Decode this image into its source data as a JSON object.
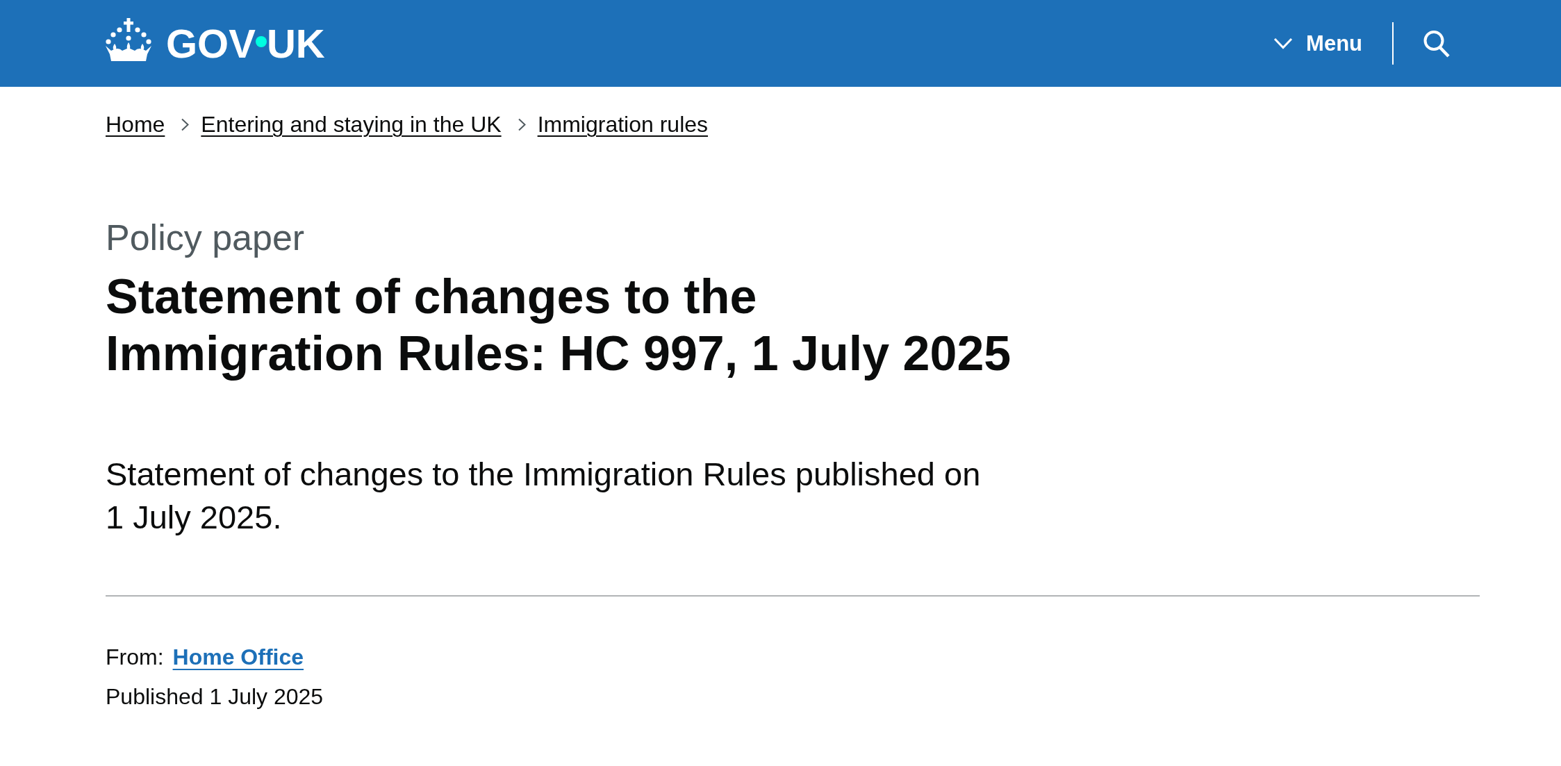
{
  "header": {
    "logo": {
      "text_before_dot": "GOV",
      "text_after_dot": "UK"
    },
    "menu_button": {
      "label": "Menu",
      "expanded": false
    }
  },
  "breadcrumbs": [
    "Home",
    "Entering and staying in the UK",
    "Immigration rules"
  ],
  "document_type": "Policy paper",
  "title": "Statement of changes to the Immigration Rules: HC 997, 1 July 2025",
  "summary": "Statement of changes to the Immigration Rules published on 1 July 2025.",
  "metadata": {
    "from_label": "From:",
    "organisations": [
      "Home Office"
    ],
    "published": "Published 1 July 2025"
  }
}
